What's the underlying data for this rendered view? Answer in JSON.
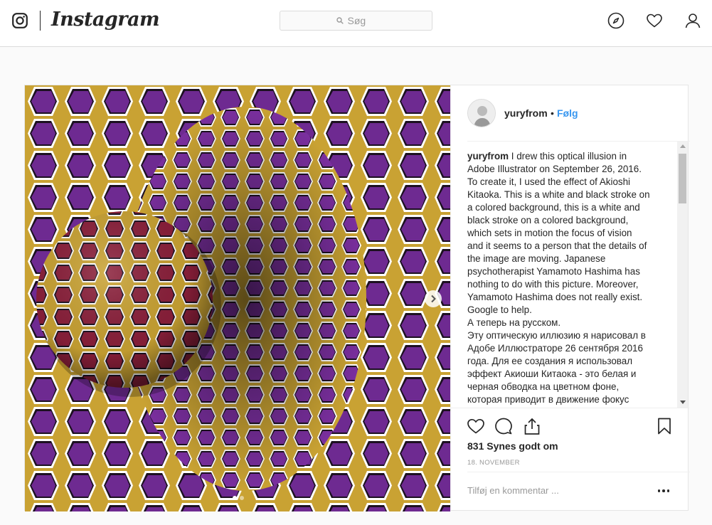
{
  "header": {
    "logo_text": "Instagram",
    "search_placeholder": "Søg"
  },
  "post": {
    "username": "yuryfrom",
    "separator": "•",
    "follow_label": "Følg",
    "caption_user": "yuryfrom",
    "caption_lines": [
      "I drew this optical illusion in",
      "Adobe Illustrator on September 26, 2016.",
      "To create it, I used the effect of Akioshi",
      "Kitaoka. This is a white and black stroke on",
      "a colored background, this is a white and",
      "black stroke on a colored background,",
      "which sets in motion the focus of vision",
      "and it seems to a person that the details of",
      "the image are moving. Japanese",
      "psychotherapist Yamamoto Hashima has",
      "nothing to do with this picture. Moreover,",
      "Yamamoto Hashima does not really exist.",
      "Google to help.",
      "А теперь на русском.",
      "Эту оптическую иллюзию я нарисовал в",
      "Адобе Иллюстраторе 26 сентября 2016",
      "года. Для ее создания я использовал",
      "эффект Акиоши Китаока - это белая и",
      "черная обводка на цветном фоне,",
      "которая приводит в движение фокус"
    ],
    "likes": "831 Synes godt om",
    "date": "18. NOVEMBER",
    "comment_placeholder": "Tilføj en kommentar ...",
    "carousel": {
      "count": 2,
      "active": 0
    }
  },
  "colors": {
    "accent": "#3897f0",
    "hex_yellow": "#c9a233",
    "hex_purple": "#6e2a91",
    "ball_red": "#8a1f3a"
  }
}
